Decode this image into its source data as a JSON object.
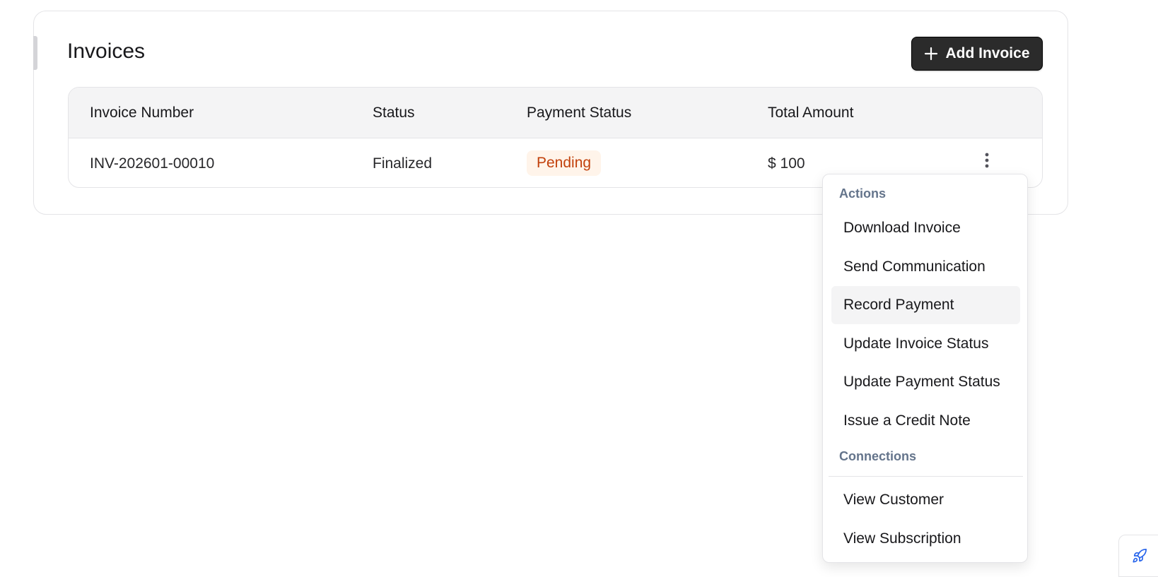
{
  "page": {
    "title": "Invoices",
    "add_button_label": "Add Invoice"
  },
  "table": {
    "columns": [
      "Invoice Number",
      "Status",
      "Payment Status",
      "Total Amount"
    ],
    "rows": [
      {
        "invoice_number": "INV-202601-00010",
        "status": "Finalized",
        "payment_status": "Pending",
        "total_amount": "$ 100"
      }
    ]
  },
  "menu": {
    "sections": [
      {
        "title": "Actions",
        "items": [
          "Download Invoice",
          "Send Communication",
          "Record Payment",
          "Update Invoice Status",
          "Update Payment Status",
          "Issue a Credit Note"
        ]
      },
      {
        "title": "Connections",
        "items": [
          "View Customer",
          "View Subscription"
        ]
      }
    ],
    "highlighted_item": "Record Payment"
  },
  "icons": {
    "add": "plus-icon",
    "row_actions": "more-vertical-icon",
    "widget": "rocket-icon"
  },
  "colors": {
    "primary_button": "#2b2b2b",
    "pending_text": "#c2410c",
    "pending_bg": "#fff4ea",
    "section_label": "#64748b",
    "widget_icon": "#2563eb"
  }
}
